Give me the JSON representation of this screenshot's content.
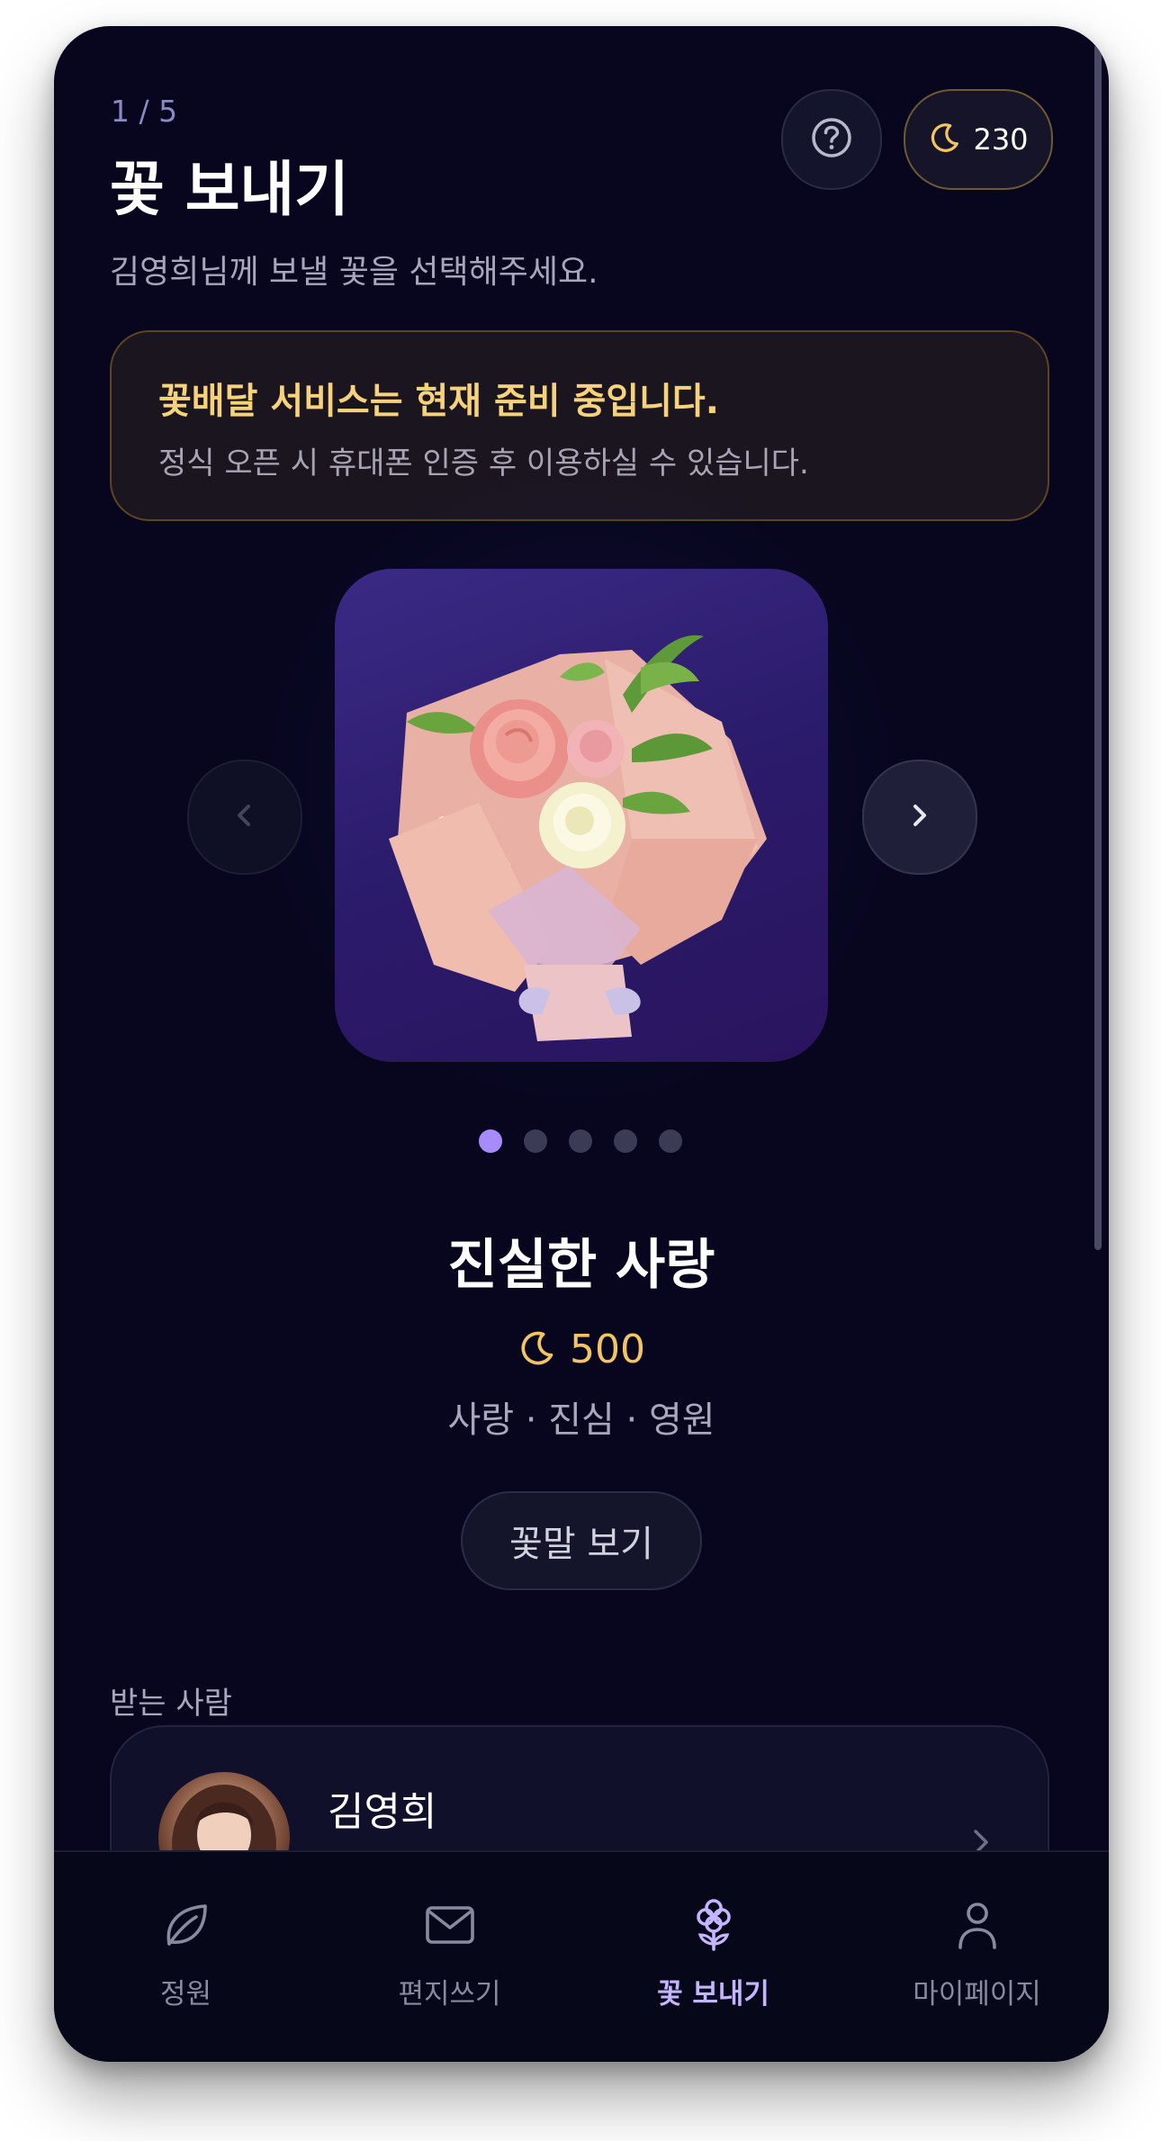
{
  "header": {
    "step": "1 / 5",
    "title": "꽃 보내기",
    "subtitle": "김영희님께 보낼 꽃을 선택해주세요.",
    "points": "230",
    "help_icon": "question-circle-icon",
    "points_icon": "moon-icon"
  },
  "notice": {
    "title": "꽃배달 서비스는 현재 준비 중입니다.",
    "body": "정식 오픈 시 휴대폰 인증 후 이용하실 수 있습니다."
  },
  "carousel": {
    "total": 5,
    "active_index": 0,
    "prev_icon": "chevron-left-icon",
    "next_icon": "chevron-right-icon"
  },
  "flower": {
    "name": "진실한 사랑",
    "price": "500",
    "tags": "사랑 · 진심 · 영원",
    "meaning_button": "꽃말 보기"
  },
  "recipient": {
    "label": "받는 사람",
    "name": "김영희"
  },
  "tabbar": {
    "items": [
      {
        "label": "정원",
        "icon": "leaf-icon"
      },
      {
        "label": "편지쓰기",
        "icon": "mail-icon"
      },
      {
        "label": "꽃 보내기",
        "icon": "flower-icon"
      },
      {
        "label": "마이페이지",
        "icon": "user-icon"
      }
    ],
    "active": 2
  },
  "colors": {
    "background": "#07061e",
    "accent": "#a78bfa",
    "gold": "#f2c462",
    "notice_title": "#f6d27a"
  }
}
